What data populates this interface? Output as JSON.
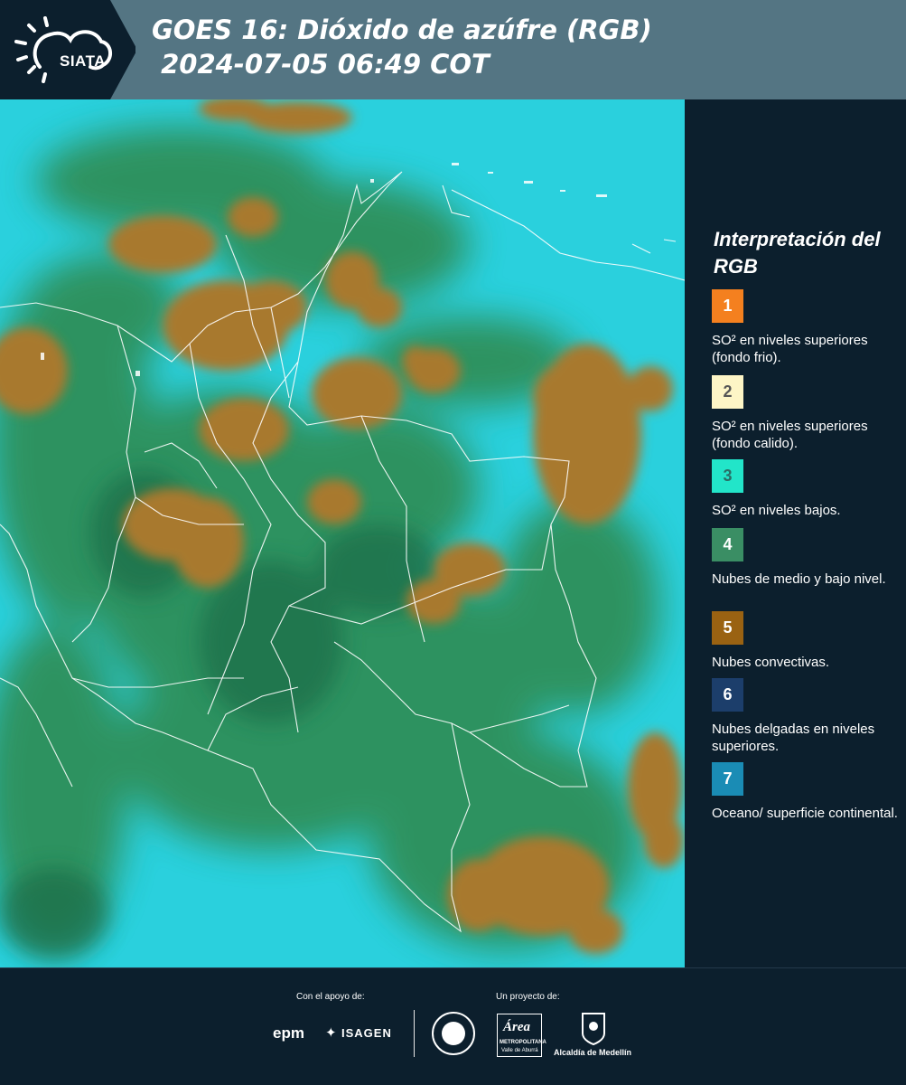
{
  "header": {
    "logo_text": "SIATA",
    "title_line1": "GOES 16: Dióxido de azúfre (RGB)",
    "title_line2": " 2024-07-05 06:49 COT"
  },
  "legend": {
    "title": "Interpretación del RGB",
    "items": [
      {
        "number": "1",
        "color": "#f4801f",
        "text_color": "#ffffff",
        "label": "SO² en niveles superiores (fondo frio)."
      },
      {
        "number": "2",
        "color": "#fdf5c6",
        "text_color": "#555555",
        "label": "SO² en niveles superiores (fondo calido)."
      },
      {
        "number": "3",
        "color": "#22e5c9",
        "text_color": "#2a6e66",
        "label": "SO² en niveles bajos."
      },
      {
        "number": "4",
        "color": "#3a8e64",
        "text_color": "#ffffff",
        "label": "Nubes de medio y bajo nivel."
      },
      {
        "number": "5",
        "color": "#9a6212",
        "text_color": "#ffffff",
        "label": "Nubes convectivas."
      },
      {
        "number": "6",
        "color": "#1c3e6b",
        "text_color": "#ffffff",
        "label": "Nubes delgadas en niveles superiores."
      },
      {
        "number": "7",
        "color": "#1a8cb5",
        "text_color": "#ffffff",
        "label": "Oceano/ superficie continental."
      }
    ]
  },
  "footer": {
    "support_caption": "Con el apoyo de:",
    "project_caption": "Un proyecto de:",
    "sponsor_epm": "epm",
    "sponsor_isagen": "ISAGEN",
    "sponsor_area": "Área",
    "sponsor_area_sub": "METROPOLITANA",
    "sponsor_area_sub2": "Valle de Aburrá",
    "sponsor_alcaldia": "Alcaldía de Medellín"
  },
  "colors": {
    "header_bg": "#547583",
    "panel_bg": "#0c1f2d",
    "sky_cyan": "#2ad4e2",
    "vegetation_green": "#2f8f52",
    "convective_brown": "#a8782c"
  }
}
